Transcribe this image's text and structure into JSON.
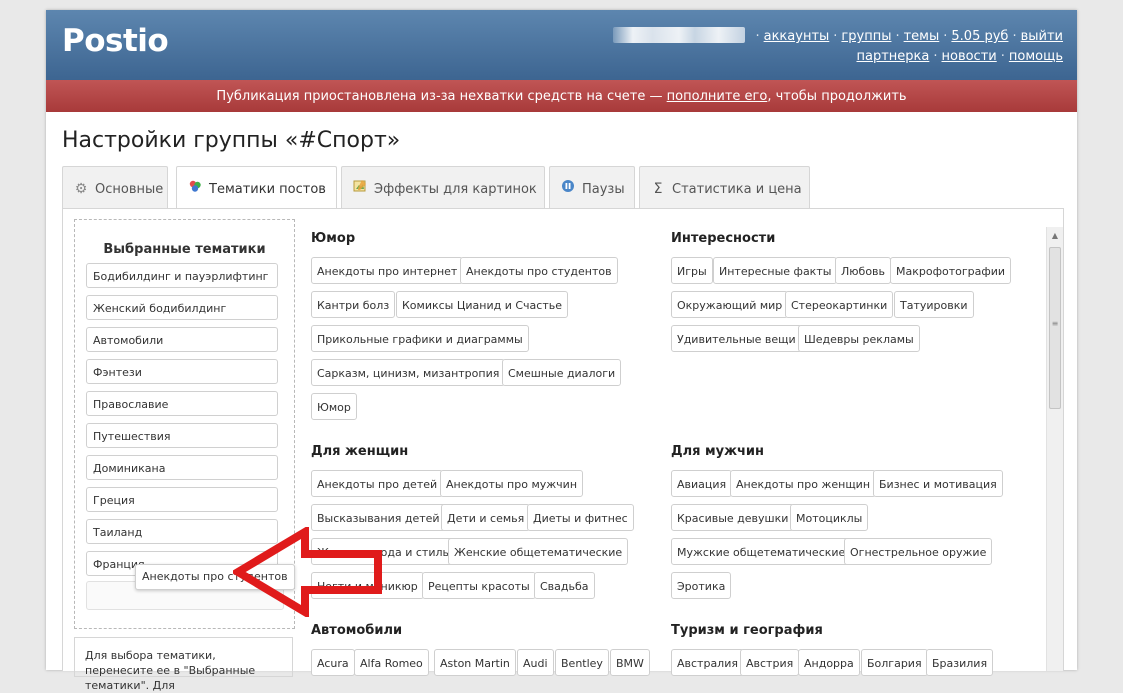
{
  "app": {
    "logo": "Postio"
  },
  "topnav": {
    "links_row1": [
      "аккаунты",
      "группы",
      "темы",
      "5.05 руб",
      "выйти"
    ],
    "links_row2": [
      "партнерка",
      "новости",
      "помощь"
    ]
  },
  "alert": {
    "text_before": "Публикация приостановлена из-за нехватки средств на счете — ",
    "link": "пополните его",
    "text_after": ", чтобы продолжить"
  },
  "page_title": "Настройки группы «#Спорт»",
  "tabs": [
    {
      "label": "Основные",
      "icon": "gear-icon"
    },
    {
      "label": "Тематики постов",
      "icon": "topics-icon"
    },
    {
      "label": "Эффекты для картинок",
      "icon": "image-effects-icon"
    },
    {
      "label": "Паузы",
      "icon": "pause-icon"
    },
    {
      "label": "Статистика и цена",
      "icon": "sigma-icon"
    }
  ],
  "selected": {
    "title": "Выбранные тематики",
    "items": [
      "Бодибилдинг и пауэрлифтинг",
      "Женский бодибилдинг",
      "Автомобили",
      "Фэнтези",
      "Православие",
      "Путешествия",
      "Доминикана",
      "Греция",
      "Таиланд",
      "Франция"
    ],
    "dragging": "Анекдоты про студентов",
    "hint": "Для выбора тематики, перенесите ее в \"Выбранные тематики\". Для"
  },
  "categories": [
    {
      "title": "Юмор",
      "chips": [
        "Анекдоты про интернет",
        "Анекдоты про студентов",
        "Кантри болз",
        "Комиксы Цианид и Счастье",
        "Прикольные графики и диаграммы",
        "Сарказм, цинизм, мизантропия",
        "Смешные диалоги",
        "Юмор"
      ]
    },
    {
      "title": "Интересности",
      "chips": [
        "Игры",
        "Интересные факты",
        "Любовь",
        "Макрофотографии",
        "Окружающий мир",
        "Стереокартинки",
        "Татуировки",
        "Удивительные вещи",
        "Шедевры рекламы"
      ]
    },
    {
      "title": "Для женщин",
      "chips": [
        "Анекдоты про детей",
        "Анекдоты про мужчин",
        "Высказывания детей",
        "Дети и семья",
        "Диеты и фитнес",
        "Женская мода и стиль",
        "Женские общетематические",
        "Ногти и маникюр",
        "Рецепты красоты",
        "Свадьба"
      ]
    },
    {
      "title": "Для мужчин",
      "chips": [
        "Авиация",
        "Анекдоты про женщин",
        "Бизнес и мотивация",
        "Красивые девушки",
        "Мотоциклы",
        "Мужские общетематические",
        "Огнестрельное оружие",
        "Эротика"
      ]
    },
    {
      "title": "Автомобили",
      "chips": [
        "Acura",
        "Alfa Romeo",
        "Aston Martin",
        "Audi",
        "Bentley",
        "BMW"
      ]
    },
    {
      "title": "Туризм и география",
      "chips": [
        "Австралия",
        "Австрия",
        "Андорра",
        "Болгария",
        "Бразилия"
      ]
    }
  ],
  "colors": {
    "header": "#4a73a0",
    "alert": "#b34545",
    "arrow": "#e01b1b"
  }
}
